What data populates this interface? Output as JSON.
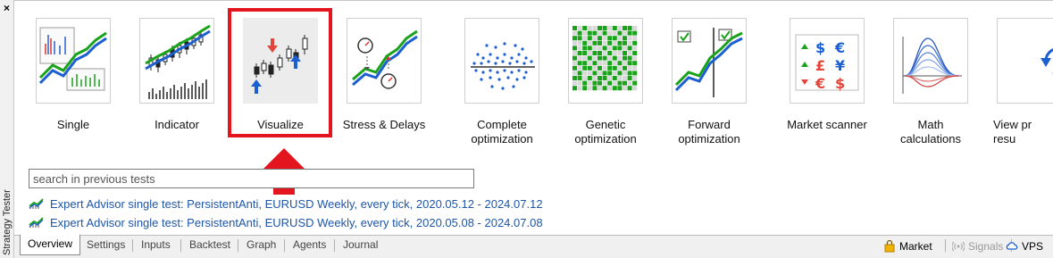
{
  "window": {
    "close_label": "×",
    "vertical_title": "Strategy Tester"
  },
  "modes": [
    {
      "label": "Single",
      "icon": "single-test-icon"
    },
    {
      "label": "Indicator",
      "icon": "indicator-test-icon"
    },
    {
      "label": "Visualize",
      "icon": "visualize-icon",
      "selected": true
    },
    {
      "label": "Stress & Delays",
      "icon": "stress-delays-icon"
    },
    {
      "label": "Complete\noptimization",
      "icon": "complete-optimization-icon"
    },
    {
      "label": "Genetic\noptimization",
      "icon": "genetic-optimization-icon"
    },
    {
      "label": "Forward\noptimization",
      "icon": "forward-optimization-icon"
    },
    {
      "label": "Market scanner",
      "icon": "market-scanner-icon"
    },
    {
      "label": "Math\ncalculations",
      "icon": "math-calculations-icon"
    },
    {
      "label": "View pr\nresu",
      "icon": "view-previous-results-icon"
    }
  ],
  "search": {
    "placeholder": "search in previous tests"
  },
  "history": [
    "Expert Advisor single test: PersistentAnti, EURUSD Weekly, every tick, 2020.05.12 - 2024.07.12",
    "Expert Advisor single test: PersistentAnti, EURUSD Weekly, every tick, 2020.05.08 - 2024.07.08"
  ],
  "tabs": {
    "overview": "Overview",
    "settings": "Settings",
    "inputs": "Inputs",
    "backtest": "Backtest",
    "graph": "Graph",
    "agents": "Agents",
    "journal": "Journal"
  },
  "status": {
    "market": "Market",
    "signals": "Signals",
    "vps": "VPS"
  },
  "colors": {
    "highlight": "#e3151f",
    "link": "#1e56a8",
    "chart_blue": "#1c5fd1",
    "chart_green": "#1aa31a"
  }
}
